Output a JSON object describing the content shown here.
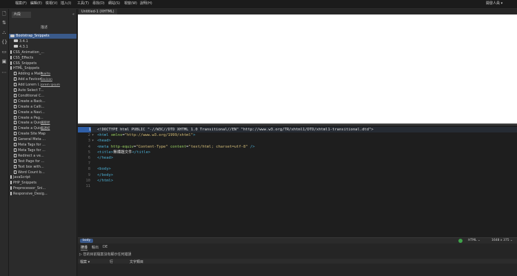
{
  "menubar": {
    "items": [
      "檔案(F)",
      "編輯(E)",
      "檢視(V)",
      "插入(I)",
      "工具(T)",
      "尋找(D)",
      "網站(S)",
      "視窗(W)",
      "說明(H)"
    ],
    "user": "開發人員 ▾"
  },
  "panel": {
    "tab_label": "片段",
    "header_desc": "描述",
    "rows": [
      {
        "label": "Bootstrap_Snippets",
        "kind": "folder",
        "level": 0,
        "selected": true
      },
      {
        "label": "3.4.1",
        "kind": "folder",
        "level": 1
      },
      {
        "label": "4.3.1",
        "kind": "folder",
        "level": 1
      },
      {
        "label": "CSS_Animation_...",
        "kind": "bar",
        "level": 0
      },
      {
        "label": "CSS_Effects",
        "kind": "bar",
        "level": 0
      },
      {
        "label": "CSS_Snippets",
        "kind": "bar",
        "level": 0
      },
      {
        "label": "HTML_Snippets",
        "kind": "bar",
        "level": 0
      },
      {
        "label": "Adding a Mailt...",
        "kind": "doc",
        "level": 1,
        "desc": "mailto"
      },
      {
        "label": "Add a Favicon",
        "kind": "doc",
        "level": 1,
        "desc": "Favicon"
      },
      {
        "label": "Add Lorem I...",
        "kind": "doc",
        "level": 1,
        "desc": "lorem ipsum"
      },
      {
        "label": "Auto Select T...",
        "kind": "doc",
        "level": 1
      },
      {
        "label": "Conditional C...",
        "kind": "doc",
        "level": 1
      },
      {
        "label": "Create a Back...",
        "kind": "doc",
        "level": 1
      },
      {
        "label": "Create a Calli...",
        "kind": "doc",
        "level": 1
      },
      {
        "label": "Create a Navi...",
        "kind": "doc",
        "level": 1
      },
      {
        "label": "Create a Pag...",
        "kind": "doc",
        "level": 1
      },
      {
        "label": "Create a Quic...",
        "kind": "doc",
        "level": 1,
        "desc": "選取狀"
      },
      {
        "label": "Create a Quic...",
        "kind": "doc",
        "level": 1,
        "desc": "超連結"
      },
      {
        "label": "Create Site Map",
        "kind": "doc",
        "level": 1
      },
      {
        "label": "General Meta ...",
        "kind": "doc",
        "level": 1
      },
      {
        "label": "Meta Tags for ...",
        "kind": "doc",
        "level": 1
      },
      {
        "label": "Meta Tags for ...",
        "kind": "doc",
        "level": 1
      },
      {
        "label": "Redirect a ve...",
        "kind": "doc",
        "level": 1
      },
      {
        "label": "Test Page for ...",
        "kind": "doc",
        "level": 1
      },
      {
        "label": "Text box with...",
        "kind": "doc",
        "level": 1
      },
      {
        "label": "Word Count b...",
        "kind": "doc",
        "level": 1
      },
      {
        "label": "JavaScript",
        "kind": "bar",
        "level": 0
      },
      {
        "label": "PHP_Snippets",
        "kind": "bar",
        "level": 0
      },
      {
        "label": "Preprocessor_Sni...",
        "kind": "bar",
        "level": 0
      },
      {
        "label": "Responsive_Desig...",
        "kind": "bar",
        "level": 0
      }
    ]
  },
  "document": {
    "tab_label": "Untitled-1 (XHTML)"
  },
  "code": {
    "current_line": 1,
    "lines": [
      {
        "n": "1",
        "fold": "",
        "tokens": [
          [
            "t-doc",
            "<!DOCTYPE html PUBLIC \"-//W3C//DTD XHTML 1.0 Transitional//EN\" \"http://www.w3.org/TR/xhtml1/DTD/xhtml1-transitional.dtd\">"
          ]
        ]
      },
      {
        "n": "2",
        "fold": "▾",
        "tokens": [
          [
            "t-tag",
            "<html "
          ],
          [
            "t-attr",
            "xmlns"
          ],
          [
            "t-txt",
            "="
          ],
          [
            "t-val",
            "\"http://www.w3.org/1999/xhtml\""
          ],
          [
            "t-tag",
            ">"
          ]
        ]
      },
      {
        "n": "3",
        "fold": "▾",
        "tokens": [
          [
            "t-tag",
            "<head>"
          ]
        ]
      },
      {
        "n": "4",
        "fold": "",
        "tokens": [
          [
            "t-tag",
            "<meta "
          ],
          [
            "t-attr",
            "http-equiv"
          ],
          [
            "t-txt",
            "="
          ],
          [
            "t-val",
            "\"Content-Type\" "
          ],
          [
            "t-attr",
            "content"
          ],
          [
            "t-txt",
            "="
          ],
          [
            "t-val",
            "\"text/html; charset=utf-8\" "
          ],
          [
            "t-tag",
            "/>"
          ]
        ]
      },
      {
        "n": "5",
        "fold": "",
        "tokens": [
          [
            "t-tag",
            "<title>"
          ],
          [
            "t-txt",
            "無標題文件"
          ],
          [
            "t-tag",
            "</title>"
          ]
        ]
      },
      {
        "n": "6",
        "fold": "",
        "tokens": [
          [
            "t-tag",
            "</head>"
          ]
        ]
      },
      {
        "n": "7",
        "fold": "",
        "tokens": []
      },
      {
        "n": "8",
        "fold": "",
        "tokens": [
          [
            "t-tag",
            "<body>"
          ]
        ]
      },
      {
        "n": "9",
        "fold": "",
        "tokens": [
          [
            "t-tag",
            "</body>"
          ]
        ]
      },
      {
        "n": "10",
        "fold": "",
        "tokens": [
          [
            "t-tag",
            "</html>"
          ]
        ]
      },
      {
        "n": "11",
        "fold": "",
        "tokens": []
      }
    ]
  },
  "statusbar": {
    "tag": "body",
    "doctype": "HTML ⌄",
    "window_size": "1648 x 375 ⌄"
  },
  "bottom": {
    "tabs": [
      "搜尋",
      "輸出",
      "DE"
    ],
    "message": "您的目前檔案沒有顯示任何錯誤",
    "columns": [
      "檔案 ▾",
      "行",
      "文字類目"
    ]
  },
  "colors": {
    "selection": "#3a5a8a",
    "tag": "#4cb1d6",
    "attribute": "#9cd662",
    "value": "#d7c07a"
  }
}
